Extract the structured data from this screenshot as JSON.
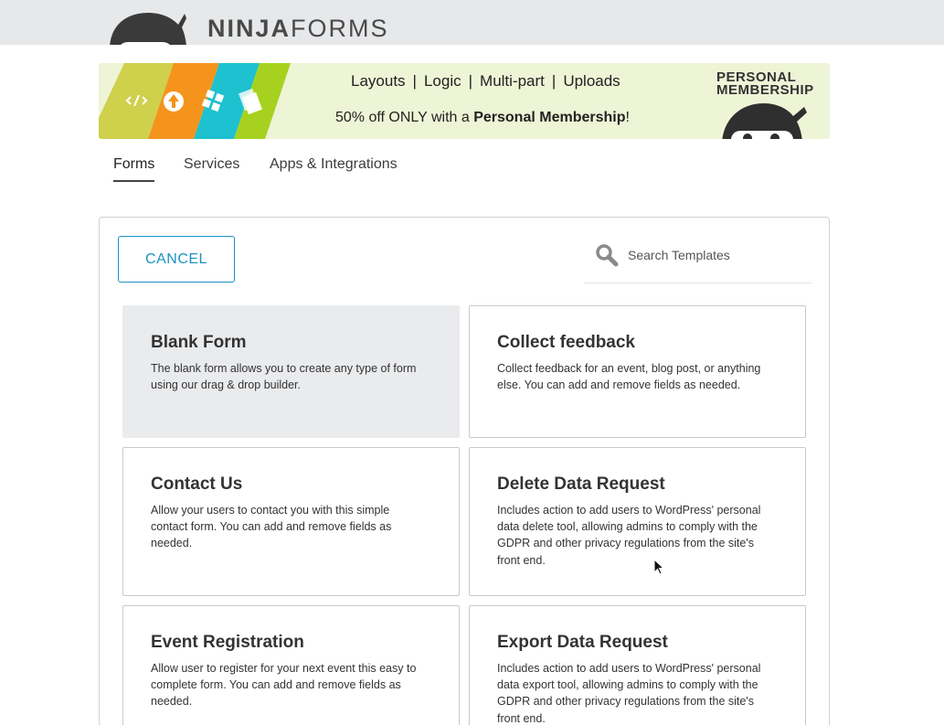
{
  "header": {
    "logo_bold": "NINJA",
    "logo_light": "FORMS"
  },
  "banner": {
    "features": [
      "Layouts",
      "Logic",
      "Multi-part",
      "Uploads"
    ],
    "separator": "|",
    "promo_prefix": "50% off ONLY with a ",
    "promo_bold": "Personal Membership",
    "promo_suffix": "!",
    "membership_line1": "PERSONAL",
    "membership_line2": "MEMBERSHIP",
    "stripe_colors": [
      "#cfd04b",
      "#f5941d",
      "#1ec1cf",
      "#a6d21f"
    ]
  },
  "tabs": [
    {
      "label": "Forms",
      "active": true
    },
    {
      "label": "Services",
      "active": false
    },
    {
      "label": "Apps & Integrations",
      "active": false
    }
  ],
  "toolbar": {
    "cancel_label": "CANCEL",
    "search_placeholder": "Search Templates"
  },
  "templates": [
    {
      "title": "Blank Form",
      "description": "The blank form allows you to create any type of form using our drag & drop builder."
    },
    {
      "title": "Collect feedback",
      "description": "Collect feedback for an event, blog post, or anything else. You can add and remove fields as needed."
    },
    {
      "title": "Contact Us",
      "description": "Allow your users to contact you with this simple contact form. You can add and remove fields as needed."
    },
    {
      "title": "Delete Data Request",
      "description": "Includes action to add users to WordPress' personal data delete tool, allowing admins to comply with the GDPR and other privacy regulations from the site's front end."
    },
    {
      "title": "Event Registration",
      "description": "Allow user to register for your next event this easy to complete form. You can add and remove fields as needed."
    },
    {
      "title": "Export Data Request",
      "description": "Includes action to add users to WordPress' personal data export tool, allowing admins to comply with the GDPR and other privacy regulations from the site's front end."
    }
  ],
  "colors": {
    "accent": "#1d91c3",
    "blank_card_bg": "#eaebed",
    "topbar_bg": "#e7e8ea"
  }
}
